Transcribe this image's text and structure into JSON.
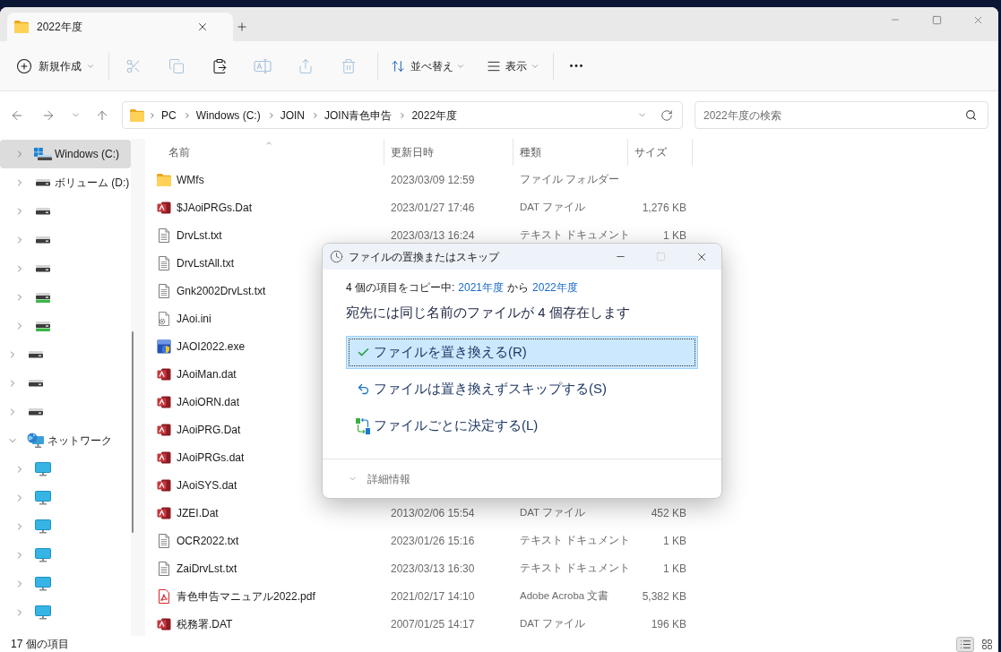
{
  "window": {
    "tabs": [
      {
        "title": "2022年度",
        "selected": true
      }
    ]
  },
  "toolbar": {
    "new_label": "新規作成",
    "actions": [
      {
        "kind": "cut",
        "disabled": true
      },
      {
        "kind": "copy",
        "disabled": true
      },
      {
        "kind": "paste",
        "disabled": false
      },
      {
        "kind": "rename",
        "disabled": true
      },
      {
        "kind": "share",
        "disabled": true
      },
      {
        "kind": "delete",
        "disabled": true
      }
    ],
    "sort_label": "並べ替え",
    "view_label": "表示"
  },
  "address_bar": {
    "path": [
      "PC",
      "Windows (C:)",
      "JOIN",
      "JOIN青色申告",
      "2022年度"
    ]
  },
  "search": {
    "placeholder": "2022年度の検索"
  },
  "sidebar": {
    "items": [
      {
        "children": [
          {
            "kind": "system",
            "label": "Windows (C:)",
            "expanded": false,
            "selected": true
          },
          {
            "kind": "drive",
            "label": "ボリューム (D:)",
            "expanded": false,
            "selected": false
          },
          {
            "kind": "drive",
            "expanded": false,
            "selected": false
          },
          {
            "kind": "drive",
            "expanded": false,
            "selected": false
          },
          {
            "kind": "drive",
            "expanded": false,
            "selected": false
          },
          {
            "kind": "removable",
            "expanded": false,
            "selected": false
          },
          {
            "kind": "removable",
            "expanded": false,
            "selected": false
          }
        ]
      },
      {
        "kind": "drive",
        "expanded": false,
        "selected": false
      },
      {
        "kind": "drive",
        "expanded": false,
        "selected": false
      },
      {
        "kind": "drive",
        "expanded": false,
        "selected": false
      },
      {
        "kind": "network",
        "label": "ネットワーク",
        "expanded": true,
        "selected": false,
        "children": [
          {
            "kind": "computer",
            "expanded": false,
            "selected": false
          },
          {
            "kind": "computer",
            "expanded": false,
            "selected": false
          },
          {
            "kind": "computer",
            "expanded": false,
            "selected": false
          },
          {
            "kind": "computer",
            "expanded": false,
            "selected": false
          },
          {
            "kind": "computer",
            "expanded": false,
            "selected": false
          },
          {
            "kind": "computer",
            "expanded": false,
            "selected": false
          }
        ]
      }
    ]
  },
  "file_list": {
    "columns": [
      {
        "label": "名前",
        "sorted": true
      },
      {
        "label": "更新日時",
        "sorted": false
      },
      {
        "label": "種類",
        "sorted": false
      },
      {
        "label": "サイズ",
        "sorted": false
      }
    ],
    "rows": [
      {
        "kind": "folder",
        "name": "WMfs",
        "modified": "2023/03/09 12:59",
        "type": "ファイル フォルダー"
      },
      {
        "kind": "data",
        "name": "$JAoiPRGs.Dat",
        "modified": "2023/01/27 17:46",
        "type": "DAT ファイル",
        "size": "1,276 KB"
      },
      {
        "kind": "text",
        "name": "DrvLst.txt",
        "modified": "2023/03/13 16:24",
        "type": "テキスト ドキュメント",
        "size": "1 KB"
      },
      {
        "kind": "text",
        "name": "DrvLstAll.txt"
      },
      {
        "kind": "text",
        "name": "Gnk2002DrvLst.txt"
      },
      {
        "kind": "settings",
        "name": "JAoi.ini"
      },
      {
        "kind": "app",
        "name": "JAOI2022.exe"
      },
      {
        "kind": "data",
        "name": "JAoiMan.dat"
      },
      {
        "kind": "data",
        "name": "JAoiORN.dat"
      },
      {
        "kind": "data",
        "name": "JAoiPRG.Dat"
      },
      {
        "kind": "data",
        "name": "JAoiPRGs.dat"
      },
      {
        "kind": "data",
        "name": "JAoiSYS.dat"
      },
      {
        "kind": "data",
        "name": "JZEI.Dat",
        "modified": "2013/02/06 15:54",
        "type": "DAT ファイル",
        "size": "452 KB"
      },
      {
        "kind": "text",
        "name": "OCR2022.txt",
        "modified": "2023/01/26 15:16",
        "type": "テキスト ドキュメント",
        "size": "1 KB"
      },
      {
        "kind": "text",
        "name": "ZaiDrvLst.txt",
        "modified": "2023/03/13 16:30",
        "type": "テキスト ドキュメント",
        "size": "1 KB"
      },
      {
        "kind": "pdf",
        "name": "青色申告マニュアル2022.pdf",
        "modified": "2021/02/17 14:10",
        "type": "Adobe Acroba 文書",
        "size": "5,382 KB"
      },
      {
        "kind": "data",
        "name": "税務署.DAT",
        "modified": "2007/01/25 14:17",
        "type": "DAT ファイル",
        "size": "196 KB"
      }
    ]
  },
  "status_bar": {
    "item_count": "17 個の項目",
    "views": [
      {
        "kind": "details",
        "selected": true
      },
      {
        "kind": "tiles",
        "selected": false
      }
    ]
  },
  "dialog": {
    "title": "ファイルの置換またはスキップ",
    "maximize_disabled": true,
    "copy_prefix": "4 個の項目をコピー中:",
    "source": "2021年度",
    "joiner": "から",
    "destination": "2022年度",
    "message": "宛先には同じ名前のファイルが 4 個存在します",
    "options": [
      {
        "kind": "replace",
        "label": "ファイルを置き換える(R)",
        "selected": true
      },
      {
        "kind": "skip",
        "label": "ファイルは置き換えずスキップする(S)",
        "selected": false
      },
      {
        "kind": "decide",
        "label": "ファイルごとに決定する(L)",
        "selected": false
      }
    ],
    "details_label": "詳細情報",
    "details_expanded": false
  }
}
